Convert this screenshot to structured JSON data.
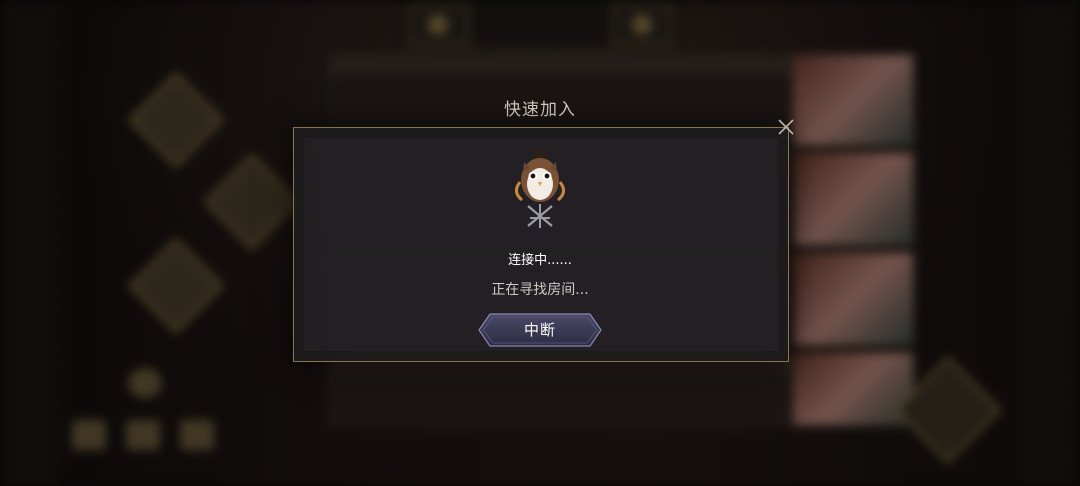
{
  "dialog": {
    "title": "快速加入",
    "status_main": "连接中......",
    "status_sub": "正在寻找房间...",
    "abort_label": "中断",
    "close_icon": "close-icon",
    "mascot_icon": "owl-mascot-icon"
  },
  "colors": {
    "frame_gold": "#8a7450",
    "button_fill": "#3a3a54",
    "button_border": "#8b87b0",
    "text_white": "#ffffff"
  }
}
